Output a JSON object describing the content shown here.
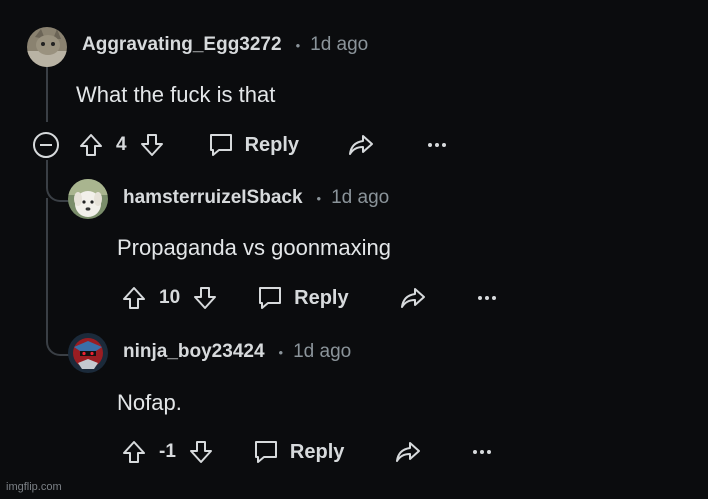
{
  "comments": [
    {
      "username": "Aggravating_Egg3272",
      "separator": "•",
      "time": "1d ago",
      "text": "What the fuck is that",
      "score": "4",
      "reply_label": "Reply",
      "avatar": "cat-avatar",
      "collapse_icon": "minus-circle-icon"
    },
    {
      "username": "hamsterruizeISback",
      "separator": "•",
      "time": "1d ago",
      "text": "Propaganda vs goonmaxing",
      "score": "10",
      "reply_label": "Reply",
      "avatar": "dog-avatar"
    },
    {
      "username": "ninja_boy23424",
      "separator": "•",
      "time": "1d ago",
      "text": "Nofap.",
      "score": "-1",
      "reply_label": "Reply",
      "avatar": "ninja-avatar"
    }
  ],
  "icons": {
    "upvote": "arrow-up-icon",
    "downvote": "arrow-down-icon",
    "reply": "speech-bubble-icon",
    "share": "share-arrow-icon",
    "more": "ellipsis-icon"
  },
  "colors": {
    "background": "#0b0c0e",
    "text": "#d7dadc",
    "muted": "#8b949a",
    "thread_line": "#3a3f45"
  },
  "watermark": "imgflip.com"
}
